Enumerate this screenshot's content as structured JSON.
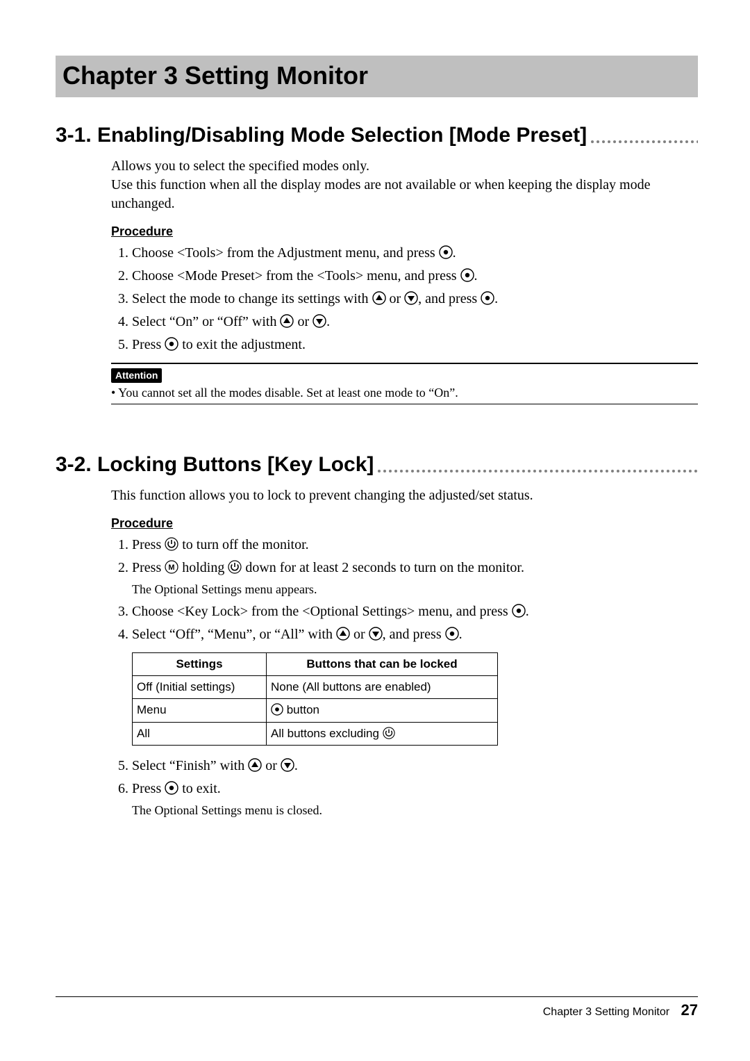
{
  "chapter_title": "Chapter 3  Setting Monitor",
  "section1": {
    "title": "3-1. Enabling/Disabling Mode Selection [Mode Preset]",
    "intro1": "Allows you to select the specified modes only.",
    "intro2": "Use this function when all the display modes are not available or when keeping the display mode unchanged.",
    "procedure_label": "Procedure",
    "steps": {
      "s1a": "Choose <Tools> from the Adjustment menu, and press ",
      "s1b": ".",
      "s2a": "Choose <Mode Preset> from the <Tools> menu, and press ",
      "s2b": ".",
      "s3a": "Select the mode to change its settings with ",
      "s3b": " or ",
      "s3c": ", and press ",
      "s3d": ".",
      "s4a": "Select “On” or “Off” with ",
      "s4b": " or ",
      "s4c": ".",
      "s5a": "Press ",
      "s5b": " to exit the adjustment."
    },
    "attention_label": "Attention",
    "attention_text": "• You cannot set all the modes disable. Set at least one mode to “On”."
  },
  "section2": {
    "title": "3-2. Locking Buttons [Key Lock]",
    "intro": "This function allows you to lock to prevent changing the adjusted/set status.",
    "procedure_label": "Procedure",
    "steps": {
      "s1a": "Press ",
      "s1b": " to turn off the monitor.",
      "s2a": "Press ",
      "s2b": " holding ",
      "s2c": " down for at least 2 seconds to turn on the monitor.",
      "s2note": "The Optional Settings menu appears.",
      "s3a": "Choose <Key Lock> from the <Optional Settings> menu, and press ",
      "s3b": ".",
      "s4a": "Select “Off”, “Menu”, or “All” with ",
      "s4b": " or ",
      "s4c": ", and press ",
      "s4d": ".",
      "s5a": "Select “Finish” with ",
      "s5b": " or ",
      "s5c": ".",
      "s6a": "Press ",
      "s6b": " to exit.",
      "s6note": "The Optional Settings menu is closed."
    },
    "table": {
      "h1": "Settings",
      "h2": "Buttons that can be locked",
      "r1c1": "Off (Initial settings)",
      "r1c2": "None (All buttons are enabled)",
      "r2c1": "Menu",
      "r2c2b": " button",
      "r3c1": "All",
      "r3c2a": "All buttons excluding "
    }
  },
  "footer": {
    "chapter": "Chapter 3  Setting Monitor",
    "page": "27"
  }
}
